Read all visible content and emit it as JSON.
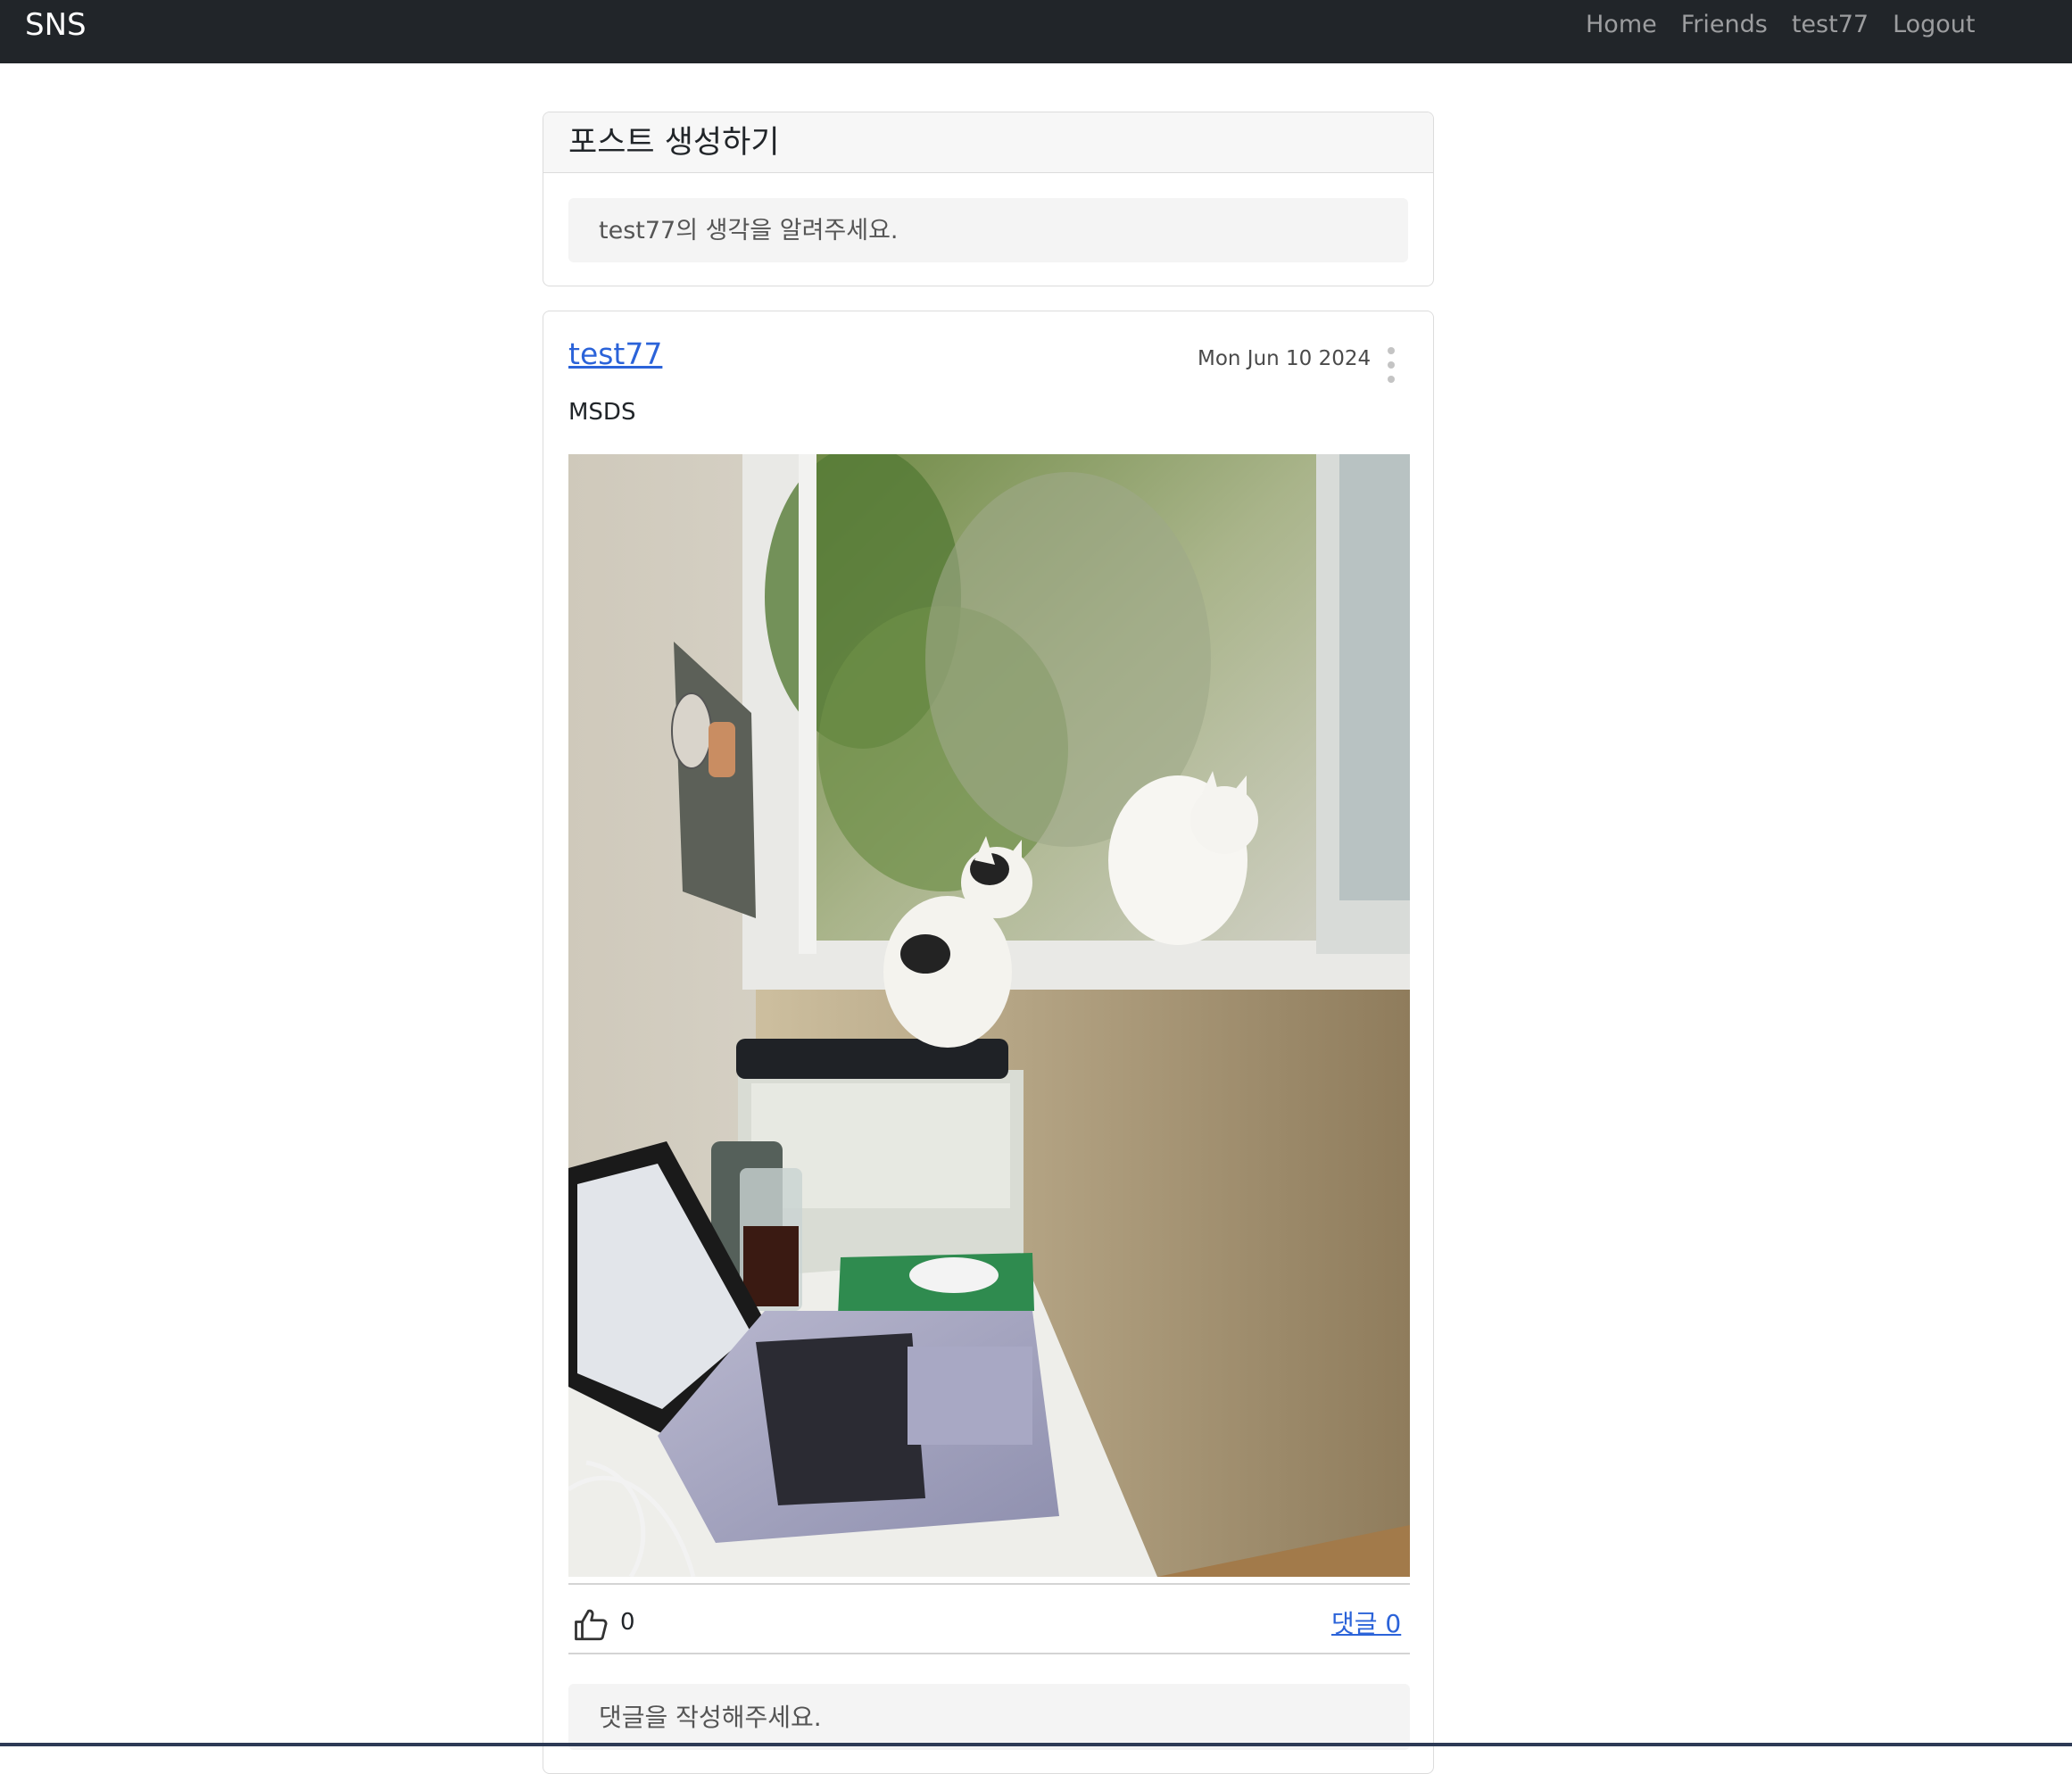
{
  "nav": {
    "brand": "SNS",
    "links": [
      "Home",
      "Friends",
      "test77",
      "Logout"
    ]
  },
  "create_post": {
    "title": "포스트 생성하기",
    "placeholder": "test77의 생각을 알려주세요."
  },
  "post": {
    "author": "test77",
    "date": "Mon Jun 10 2024",
    "content": "MSDS",
    "likes": "0",
    "comments_label": "댓글 0",
    "comment_placeholder": "댓글을 작성해주세요."
  },
  "icons": {
    "post_menu": "vertical-ellipsis-icon",
    "like": "thumbs-up-icon"
  }
}
